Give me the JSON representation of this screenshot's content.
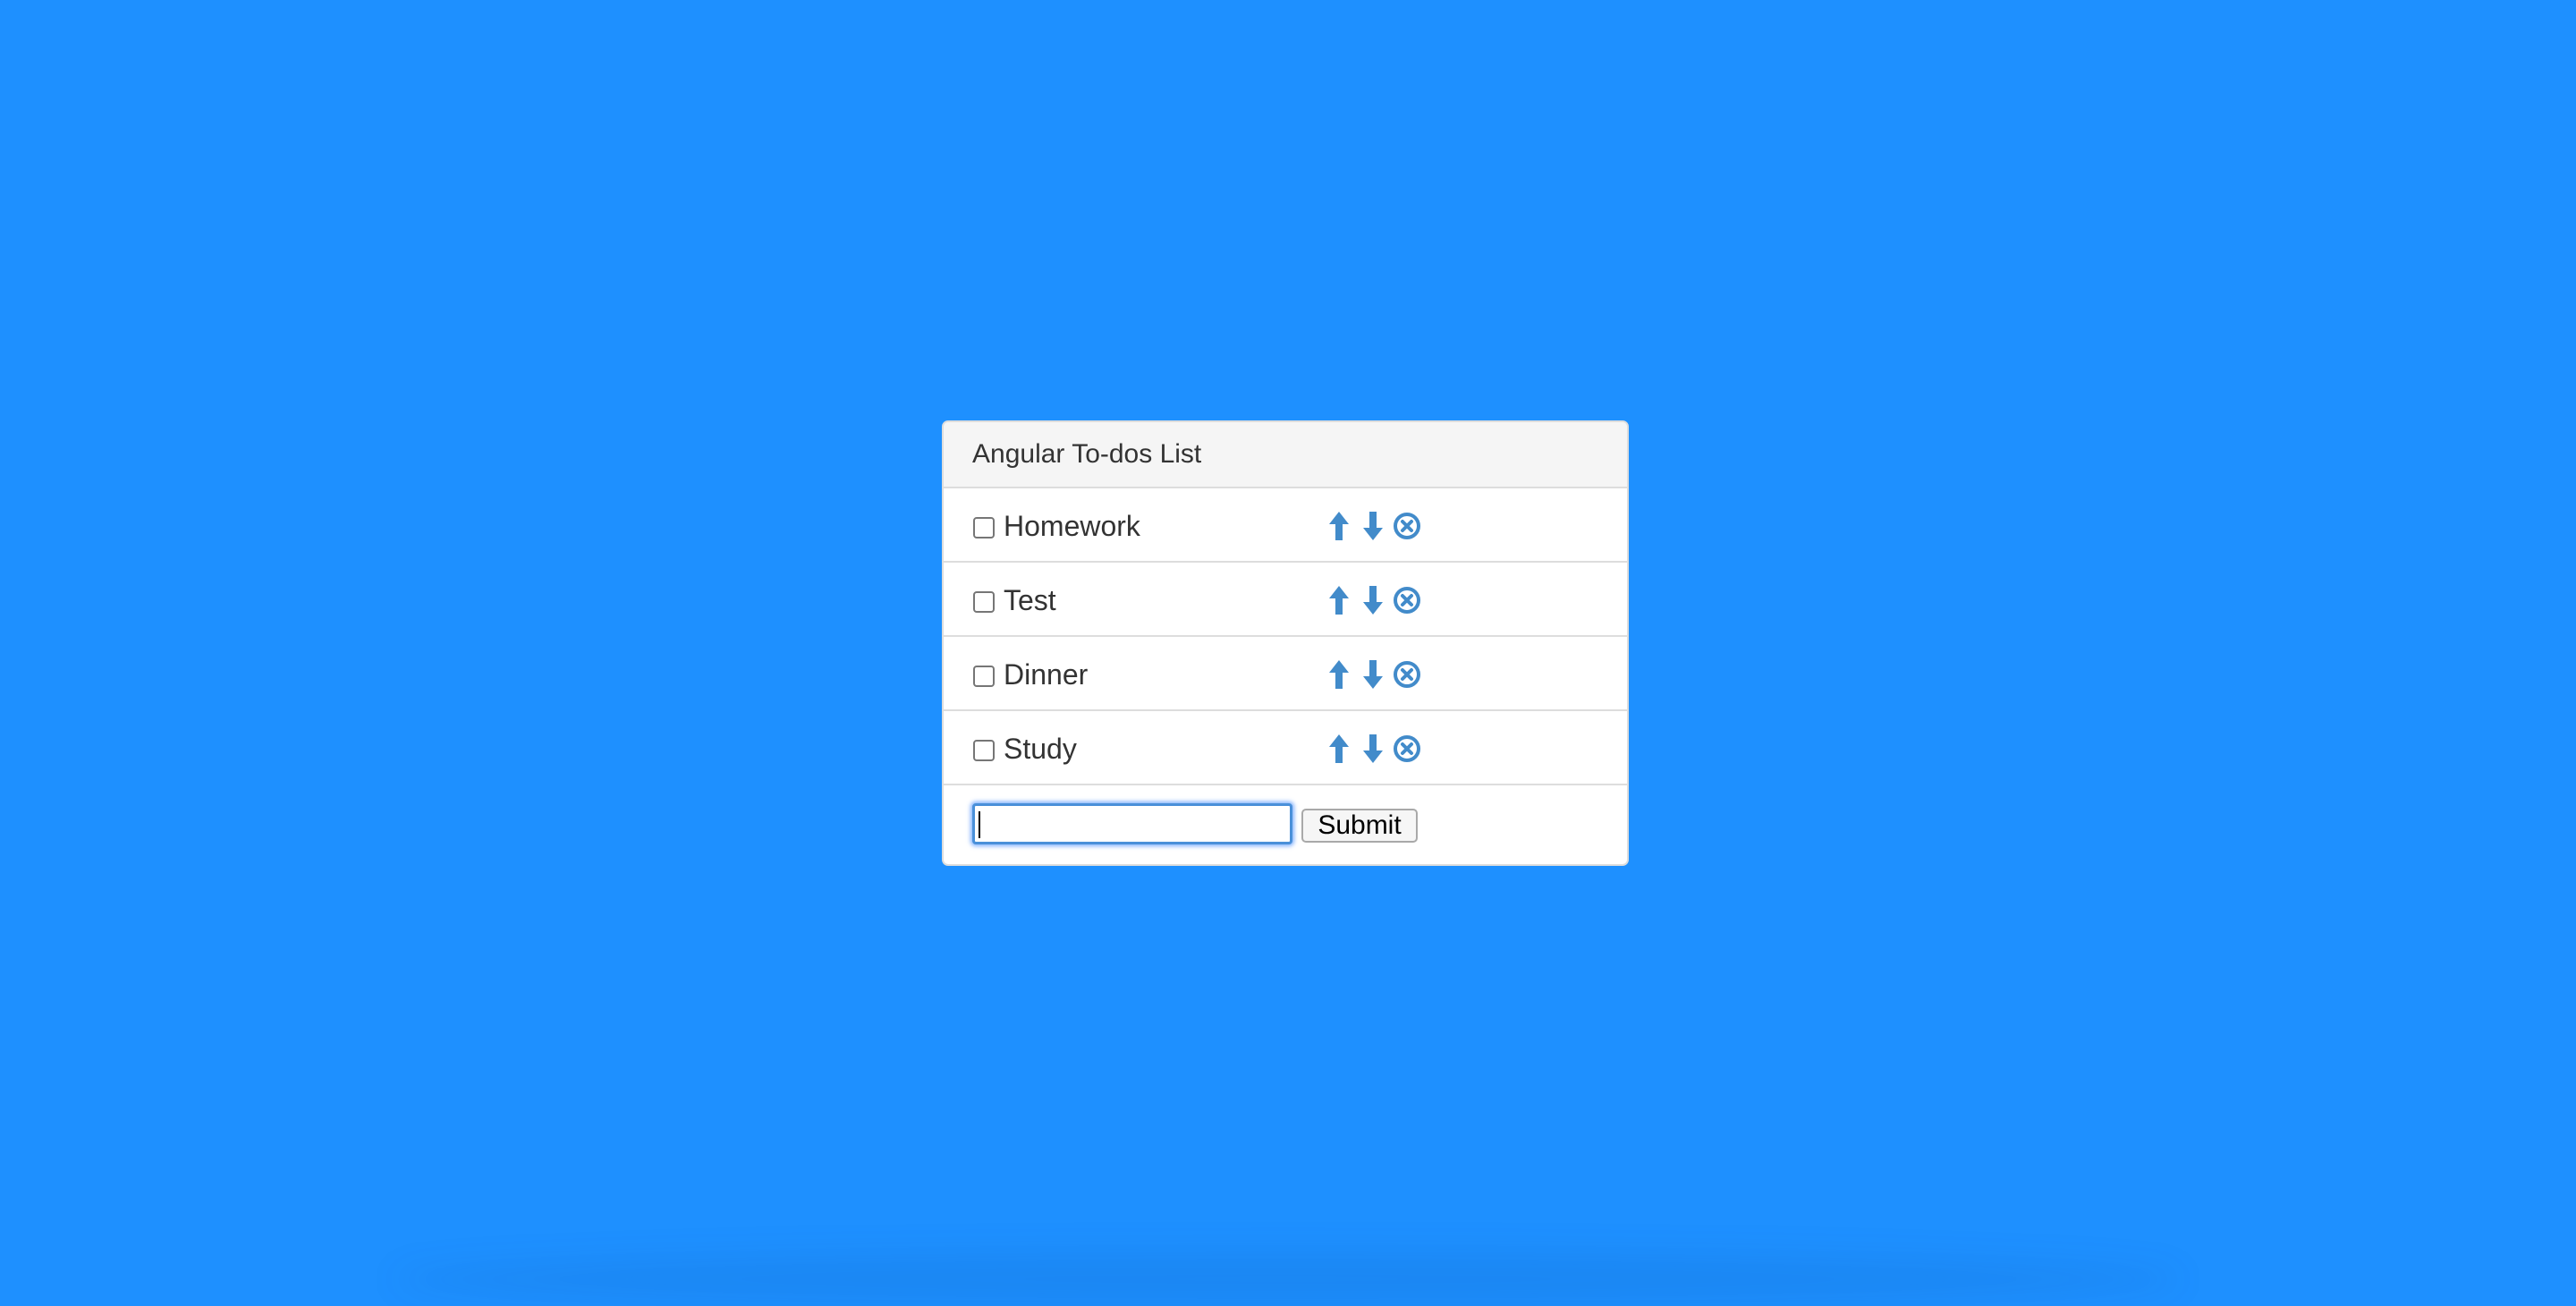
{
  "panel": {
    "title": "Angular To-dos List"
  },
  "todos": [
    {
      "label": "Homework",
      "checked": false
    },
    {
      "label": "Test",
      "checked": false
    },
    {
      "label": "Dinner",
      "checked": false
    },
    {
      "label": "Study",
      "checked": false
    }
  ],
  "form": {
    "input_value": "",
    "input_placeholder": "",
    "submit_label": "Submit"
  },
  "icons": {
    "move_up": "arrow-up-icon",
    "move_down": "arrow-down-icon",
    "remove": "remove-circle-icon"
  },
  "colors": {
    "background": "#1e90ff",
    "icon": "#428bca",
    "panel_heading": "#f5f5f5",
    "border": "#dddddd"
  }
}
